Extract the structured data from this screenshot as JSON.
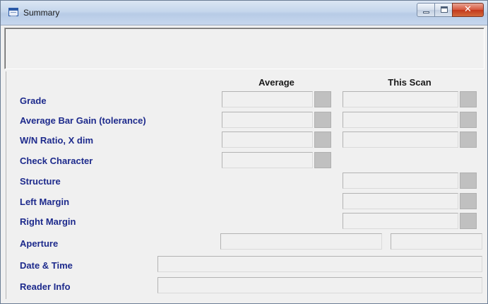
{
  "window": {
    "title": "Summary",
    "icon": "table-icon",
    "controls": {
      "minimize": "minimize-icon",
      "maximize": "maximize-icon",
      "close": "close-icon",
      "close_glyph": "✕"
    }
  },
  "columns": {
    "average": "Average",
    "this_scan": "This Scan"
  },
  "rows": {
    "grade": {
      "label": "Grade",
      "average": "",
      "this_scan": ""
    },
    "bar_gain": {
      "label": "Average Bar Gain (tolerance)",
      "average": "",
      "this_scan": ""
    },
    "wn_ratio": {
      "label": "W/N Ratio, X dim",
      "average": "",
      "this_scan": ""
    },
    "check_char": {
      "label": "Check Character",
      "average": ""
    },
    "structure": {
      "label": "Structure",
      "this_scan": ""
    },
    "left_margin": {
      "label": "Left Margin",
      "this_scan": ""
    },
    "right_margin": {
      "label": "Right Margin",
      "this_scan": ""
    },
    "aperture": {
      "label": "Aperture",
      "value1": "",
      "value2": ""
    },
    "date_time": {
      "label": "Date & Time",
      "value": ""
    },
    "reader_info": {
      "label": "Reader Info",
      "value": ""
    }
  },
  "colors": {
    "label_text": "#1d2a8c",
    "indicator": "#c0c0c0",
    "panel": "#f0f0f0"
  }
}
